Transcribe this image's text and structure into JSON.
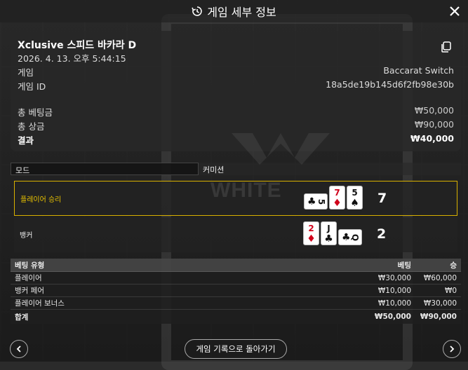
{
  "header": {
    "title": "게임 세부 정보"
  },
  "summary": {
    "game_name": "Xclusive 스피드 바카라 D",
    "date": "2026. 4. 13. 오후 5:44:15",
    "game_label": "게임",
    "game_value": "Baccarat Switch",
    "game_id_label": "게임 ID",
    "game_id_value": "18a5de19b145d6f2fb98e30b",
    "total_bet_label": "총 베팅금",
    "total_bet_value": "₩50,000",
    "total_win_label": "총 상금",
    "total_win_value": "₩90,000",
    "result_label": "결과",
    "result_value": "₩40,000"
  },
  "mode_row": {
    "mode": "모드",
    "commission": "커미션"
  },
  "outcomes": {
    "player": {
      "label": "플레이어 승리",
      "total": "7",
      "cards": [
        {
          "rank": "5",
          "suit": "♣",
          "color": "#111111",
          "sideways": true
        },
        {
          "rank": "7",
          "suit": "♦",
          "color": "#d0021b",
          "sideways": false
        },
        {
          "rank": "5",
          "suit": "♠",
          "color": "#111111",
          "sideways": false
        }
      ]
    },
    "banker": {
      "label": "뱅커",
      "total": "2",
      "cards": [
        {
          "rank": "2",
          "suit": "♦",
          "color": "#d0021b",
          "sideways": false
        },
        {
          "rank": "J",
          "suit": "♣",
          "color": "#111111",
          "sideways": false
        },
        {
          "rank": "Q",
          "suit": "♣",
          "color": "#111111",
          "sideways": true
        }
      ]
    }
  },
  "bet_table": {
    "headers": {
      "type": "베팅 유형",
      "bet": "베팅",
      "win": "승"
    },
    "rows": [
      {
        "type": "플레이어",
        "bet": "₩30,000",
        "win": "₩60,000"
      },
      {
        "type": "뱅커 페어",
        "bet": "₩10,000",
        "win": "₩0"
      },
      {
        "type": "플레이어 보너스",
        "bet": "₩10,000",
        "win": "₩30,000"
      }
    ],
    "total": {
      "type": "합계",
      "bet": "₩50,000",
      "win": "₩90,000"
    }
  },
  "footer": {
    "back_label": "게임 기록으로 돌아가기"
  },
  "background": {
    "watermark_text": "WHITE"
  },
  "colors": {
    "accent_gold": "#d9b100",
    "red_suit": "#d0021b"
  },
  "icons": {
    "history": "history-icon",
    "close": "close-icon",
    "copy": "copy-icon",
    "prev": "chevron-left-icon",
    "next": "chevron-right-icon"
  }
}
